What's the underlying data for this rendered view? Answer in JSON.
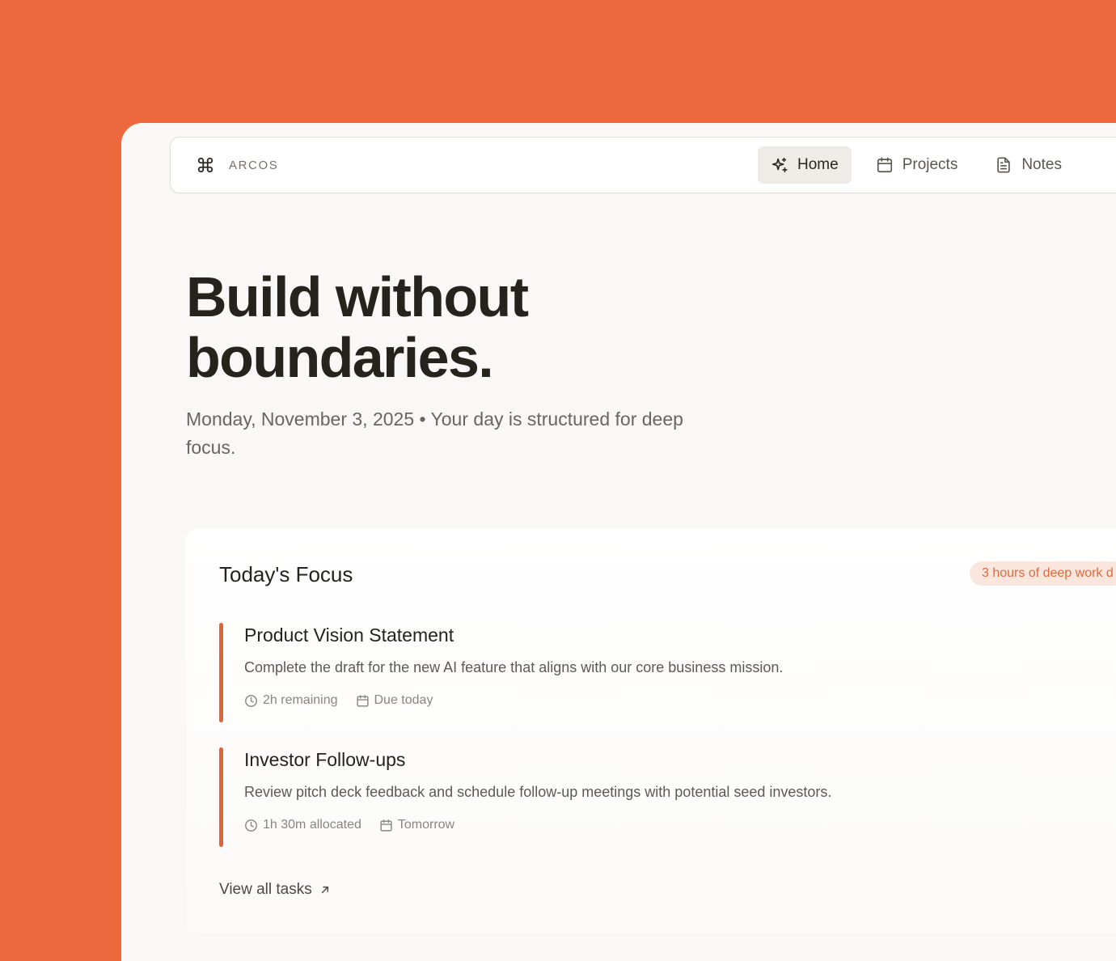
{
  "brand": {
    "name": "ARCOS",
    "icon": "command-icon"
  },
  "nav": {
    "items": [
      {
        "label": "Home",
        "icon": "sparkles-icon",
        "active": true
      },
      {
        "label": "Projects",
        "icon": "calendar-icon",
        "active": false
      },
      {
        "label": "Notes",
        "icon": "document-icon",
        "active": false
      }
    ]
  },
  "hero": {
    "title_line1": "Build without",
    "title_line2": "boundaries.",
    "subtitle": "Monday, November 3, 2025 • Your day is structured for deep focus."
  },
  "focus": {
    "title": "Today's Focus",
    "badge": "3 hours of deep work d",
    "tasks": [
      {
        "title": "Product Vision Statement",
        "description": "Complete the draft for the new AI feature that aligns with our core business mission.",
        "time": "2h remaining",
        "due": "Due today"
      },
      {
        "title": "Investor Follow-ups",
        "description": "Review pitch deck feedback and schedule follow-up meetings with potential seed investors.",
        "time": "1h 30m allocated",
        "due": "Tomorrow"
      }
    ],
    "view_all": "View all tasks"
  },
  "colors": {
    "background": "#ED693D",
    "accent": "#D9663F",
    "badge_bg": "#FBE6DD",
    "badge_text": "#E0683F",
    "window": "#F9F8F6"
  }
}
